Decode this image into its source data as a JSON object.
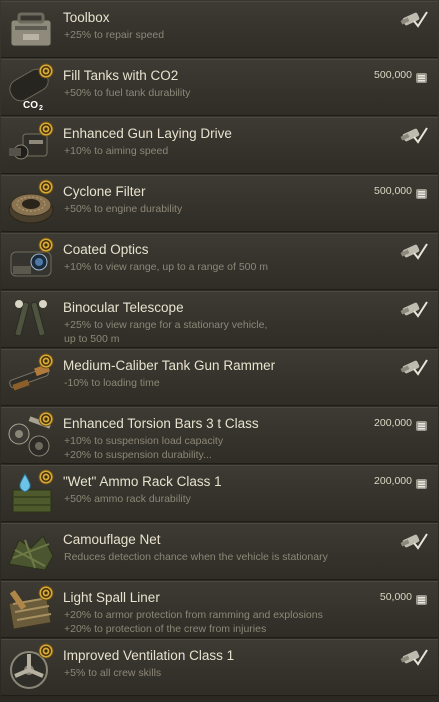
{
  "items": [
    {
      "title": "Toolbox",
      "desc": [
        "+25% to repair speed"
      ],
      "price": "",
      "owned": true,
      "badge": false,
      "icon": "toolbox-icon"
    },
    {
      "title": "Fill Tanks with CO2",
      "desc": [
        "+50% to fuel tank durability"
      ],
      "price": "500,000",
      "owned": false,
      "badge": true,
      "icon": "co2-tank-icon"
    },
    {
      "title": "Enhanced Gun Laying Drive",
      "desc": [
        "+10% to aiming speed"
      ],
      "price": "",
      "owned": true,
      "badge": true,
      "icon": "gun-laying-drive-icon"
    },
    {
      "title": "Cyclone Filter",
      "desc": [
        "+50% to engine durability"
      ],
      "price": "500,000",
      "owned": false,
      "badge": true,
      "icon": "cyclone-filter-icon"
    },
    {
      "title": "Coated Optics",
      "desc": [
        "+10% to view range, up to a range of 500 m"
      ],
      "price": "",
      "owned": true,
      "badge": true,
      "icon": "coated-optics-icon"
    },
    {
      "title": "Binocular Telescope",
      "desc": [
        "+25% to view range for a stationary vehicle,",
        "up to 500 m"
      ],
      "price": "",
      "owned": true,
      "badge": false,
      "icon": "binocular-telescope-icon"
    },
    {
      "title": "Medium-Caliber Tank Gun Rammer",
      "desc": [
        "-10% to loading time"
      ],
      "price": "",
      "owned": true,
      "badge": true,
      "icon": "gun-rammer-icon"
    },
    {
      "title": "Enhanced Torsion Bars 3 t Class",
      "desc": [
        "+10% to suspension load capacity",
        "+20% to suspension durability..."
      ],
      "price": "200,000",
      "owned": false,
      "badge": true,
      "icon": "torsion-bars-icon"
    },
    {
      "title": "\"Wet\" Ammo Rack Class 1",
      "desc": [
        "+50% ammo rack durability"
      ],
      "price": "200,000",
      "owned": false,
      "badge": true,
      "icon": "wet-ammo-rack-icon"
    },
    {
      "title": "Camouflage Net",
      "desc": [
        "Reduces detection chance when the vehicle is stationary"
      ],
      "price": "",
      "owned": true,
      "badge": false,
      "icon": "camouflage-net-icon"
    },
    {
      "title": "Light Spall Liner",
      "desc": [
        "+20% to armor protection from ramming and explosions",
        "+20% to protection of the crew from injuries"
      ],
      "price": "50,000",
      "owned": false,
      "badge": true,
      "icon": "spall-liner-icon"
    },
    {
      "title": "Improved Ventilation Class 1",
      "desc": [
        "+5% to all crew skills"
      ],
      "price": "",
      "owned": true,
      "badge": true,
      "icon": "ventilation-icon"
    }
  ],
  "colors": {
    "title": "#e8e2cf",
    "desc": "#8c8778",
    "badge": "#d9a93a",
    "price": "#dcd6c4"
  }
}
